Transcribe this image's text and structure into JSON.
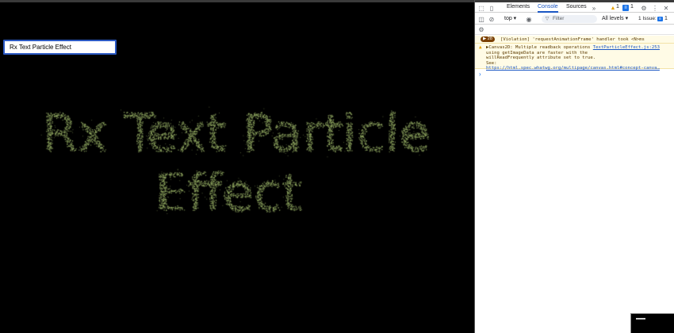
{
  "page": {
    "input_value": "Rx Text Particle Effect",
    "particle_text_line1": "Rx Text Particle",
    "particle_text_line2": "Effect",
    "particle_color": "#8fa660"
  },
  "devtools": {
    "tabs": [
      {
        "label": "Elements"
      },
      {
        "label": "Console"
      },
      {
        "label": "Sources"
      }
    ],
    "more_tabs_icon": "»",
    "warning_count": "1",
    "message_count": "1",
    "context": "top",
    "filter_placeholder": "Filter",
    "levels": "All levels",
    "issues": "1 Issue:",
    "issues_count": "1",
    "messages": {
      "violation_count": "28",
      "violation_text": "[Violation] 'requestAnimationFrame' handler took <N>ms",
      "warning_text": "▶Canvas2D: Multiple readback operations using getImageData are faster with the willReadFrequently attribute set to true. See:",
      "warning_source": "TextParticleEffect.js:253",
      "warning_link": "https://html.spec.whatwg.org/multipage/canvas.html#concept-canva…"
    },
    "prompt_symbol": "›"
  }
}
